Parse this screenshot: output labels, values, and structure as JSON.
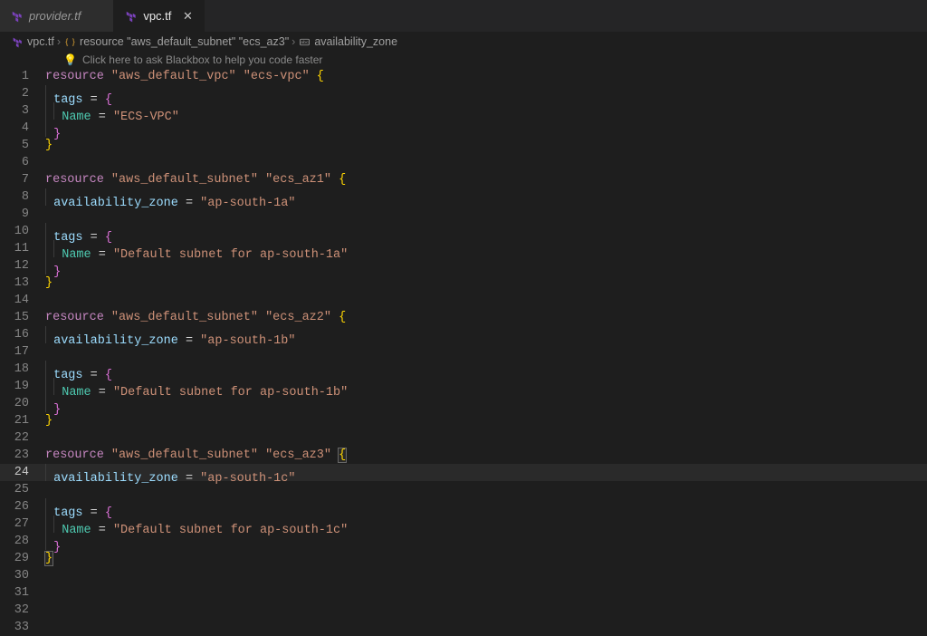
{
  "tabs": [
    {
      "label": "provider.tf",
      "active": false
    },
    {
      "label": "vpc.tf",
      "active": true
    }
  ],
  "breadcrumb": {
    "file": "vpc.tf",
    "resource": "resource \"aws_default_subnet\" \"ecs_az3\"",
    "field": "availability_zone"
  },
  "hint": "Click here to ask Blackbox to help you code faster",
  "code": {
    "current_line": 24,
    "blocks": [
      {
        "kind": "resource",
        "type_kw": "resource",
        "type": "aws_default_vpc",
        "name": "ecs-vpc",
        "body": [
          {
            "kind": "tags",
            "entries": [
              {
                "key": "Name",
                "value": "ECS-VPC"
              }
            ]
          }
        ]
      },
      {
        "kind": "resource",
        "type_kw": "resource",
        "type": "aws_default_subnet",
        "name": "ecs_az1",
        "body": [
          {
            "kind": "attr",
            "key": "availability_zone",
            "value": "ap-south-1a"
          },
          {
            "kind": "tags",
            "entries": [
              {
                "key": "Name",
                "value": "Default subnet for ap-south-1a"
              }
            ]
          }
        ]
      },
      {
        "kind": "resource",
        "type_kw": "resource",
        "type": "aws_default_subnet",
        "name": "ecs_az2",
        "body": [
          {
            "kind": "attr",
            "key": "availability_zone",
            "value": "ap-south-1b"
          },
          {
            "kind": "tags",
            "entries": [
              {
                "key": "Name",
                "value": "Default subnet for ap-south-1b"
              }
            ]
          }
        ]
      },
      {
        "kind": "resource",
        "type_kw": "resource",
        "type": "aws_default_subnet",
        "name": "ecs_az3",
        "body": [
          {
            "kind": "attr",
            "key": "availability_zone",
            "value": "ap-south-1c"
          },
          {
            "kind": "tags",
            "entries": [
              {
                "key": "Name",
                "value": "Default subnet for ap-south-1c"
              }
            ]
          }
        ]
      }
    ],
    "trailing_blank_lines": 4,
    "matched_brace_lines": [
      23,
      29
    ]
  }
}
